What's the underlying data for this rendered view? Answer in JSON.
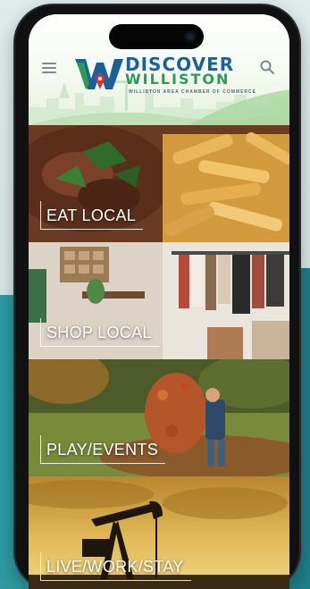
{
  "app": {
    "name": "Discover Williston",
    "logo_line1": "DISCOVER",
    "logo_line2": "WILLISTON",
    "tagline": "WILLISTON AREA CHAMBER OF COMMERCE"
  },
  "icons": {
    "menu": "hamburger-menu-icon",
    "search": "search-icon"
  },
  "colors": {
    "brand_blue": "#1d5f97",
    "brand_green": "#2c9b5a",
    "accent_teal": "#2a8f97"
  },
  "tiles": [
    {
      "label": "EAT LOCAL"
    },
    {
      "label": "SHOP LOCAL"
    },
    {
      "label": "PLAY/EVENTS"
    },
    {
      "label": "LIVE/WORK/STAY"
    }
  ]
}
